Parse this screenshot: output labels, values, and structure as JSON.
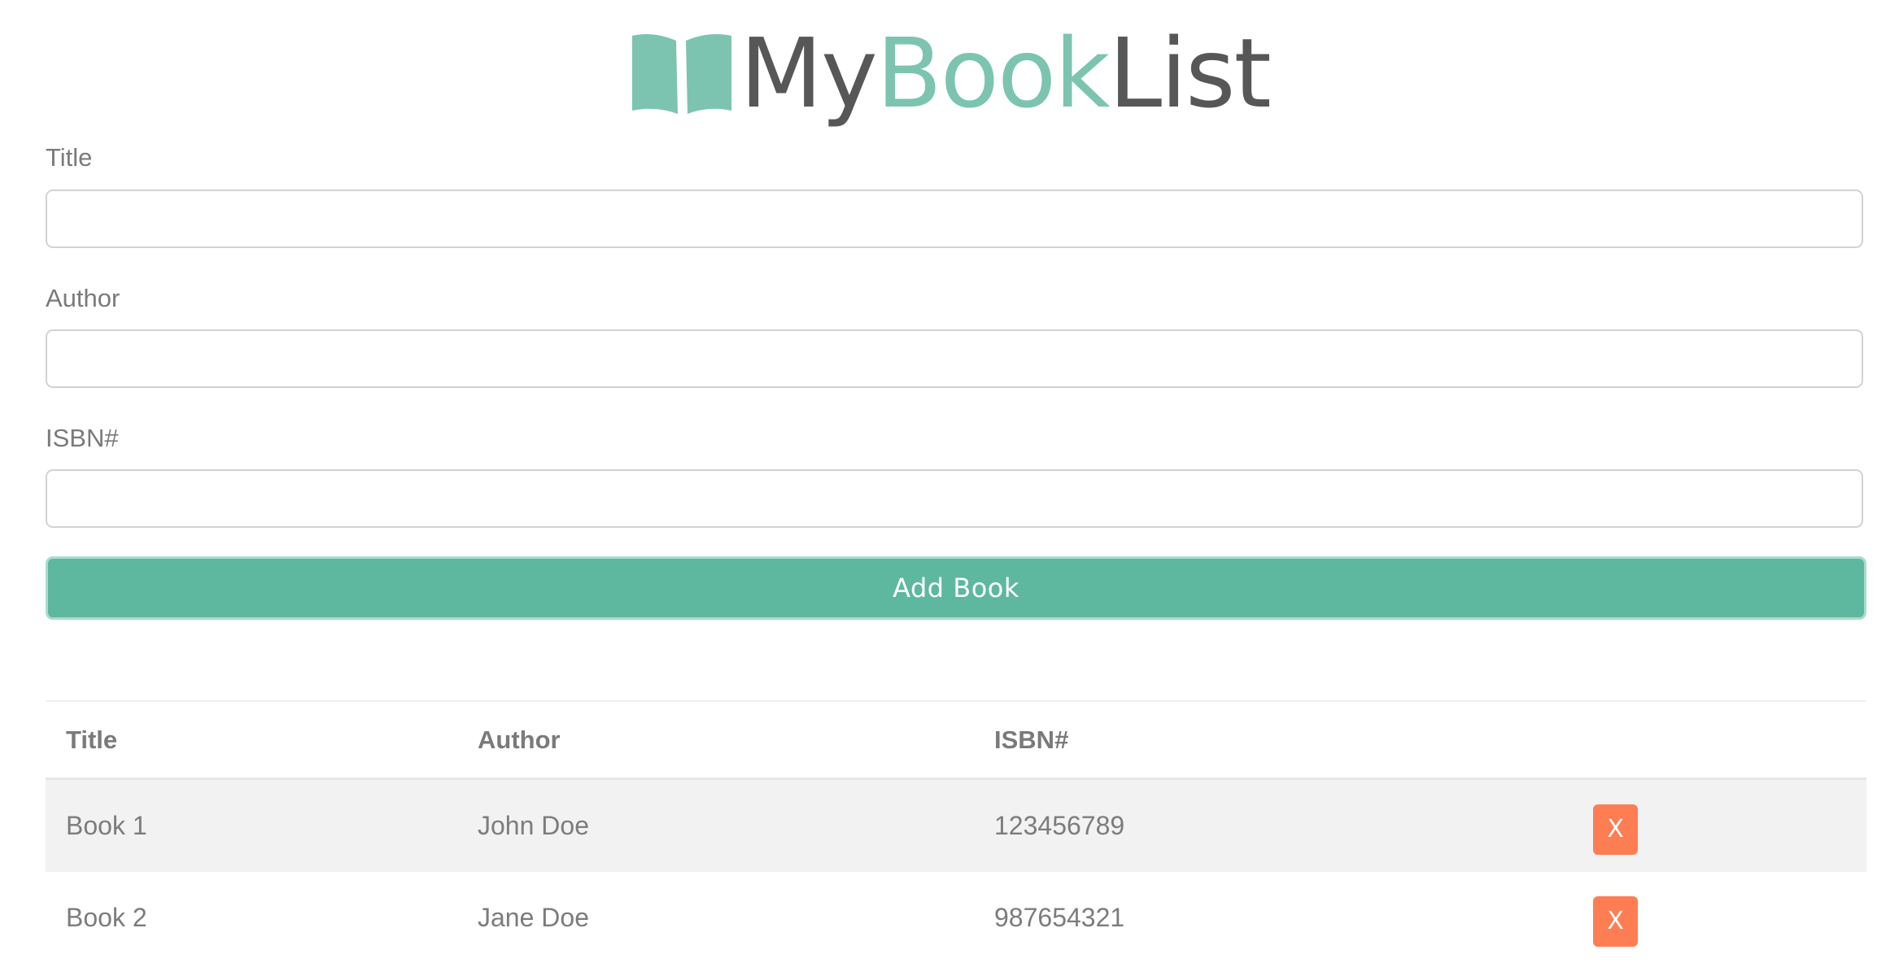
{
  "brand": {
    "logo_icon": "open-book-icon",
    "part_my": "My",
    "part_book": "Book",
    "part_list": "List",
    "accent_color": "#7cc4b0",
    "text_color": "#575757"
  },
  "form": {
    "title_label": "Title",
    "title_value": "",
    "author_label": "Author",
    "author_value": "",
    "isbn_label": "ISBN#",
    "isbn_value": "",
    "submit_label": "Add Book",
    "submit_color": "#5db89f"
  },
  "table": {
    "headers": {
      "title": "Title",
      "author": "Author",
      "isbn": "ISBN#"
    },
    "rows": [
      {
        "title": "Book 1",
        "author": "John Doe",
        "isbn": "123456789",
        "delete_label": "X"
      },
      {
        "title": "Book 2",
        "author": "Jane Doe",
        "isbn": "987654321",
        "delete_label": "X"
      }
    ],
    "delete_color": "#fe7d53"
  }
}
